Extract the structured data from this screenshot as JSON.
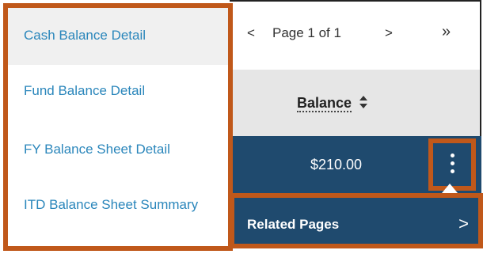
{
  "menu": {
    "items": [
      {
        "label": "Cash Balance Detail"
      },
      {
        "label": "Fund Balance Detail"
      },
      {
        "label": "FY Balance Sheet Detail"
      },
      {
        "label": "ITD Balance Sheet Summary"
      }
    ]
  },
  "pager": {
    "prev": "<",
    "label": "Page 1 of 1",
    "next": ">",
    "last": "»"
  },
  "table": {
    "column_header": "Balance",
    "row_value": "$210.00"
  },
  "related": {
    "label": "Related Pages",
    "chevron": ">"
  },
  "colors": {
    "accent_border": "#c0581a",
    "row_bg": "#1f4a6e",
    "link": "#2a86bb"
  },
  "icons": {
    "sort": "sort-up-down-icon",
    "kebab": "kebab-menu-icon"
  }
}
